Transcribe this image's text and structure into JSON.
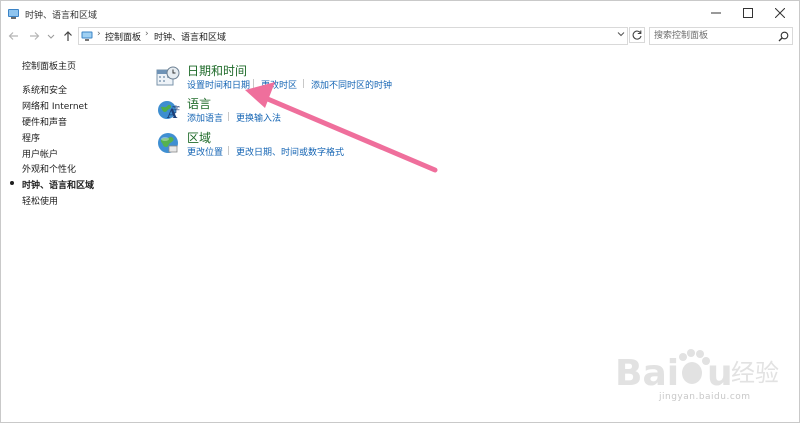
{
  "window": {
    "title": "时钟、语言和区域"
  },
  "address": {
    "crumbs": [
      "控制面板",
      "时钟、语言和区域"
    ]
  },
  "search": {
    "placeholder": "搜索控制面板"
  },
  "sidebar": {
    "items": [
      {
        "label": "控制面板主页"
      },
      {
        "label": "系统和安全"
      },
      {
        "label": "网络和 Internet"
      },
      {
        "label": "硬件和声音"
      },
      {
        "label": "程序"
      },
      {
        "label": "用户帐户"
      },
      {
        "label": "外观和个性化"
      },
      {
        "label": "时钟、语言和区域",
        "active": true
      },
      {
        "label": "轻松使用"
      }
    ]
  },
  "categories": [
    {
      "title": "日期和时间",
      "icon": "calendar-clock-icon",
      "links": [
        "设置时间和日期",
        "更改时区",
        "添加不同时区的时钟"
      ]
    },
    {
      "title": "语言",
      "icon": "language-globe-icon",
      "links": [
        "添加语言",
        "更换输入法"
      ]
    },
    {
      "title": "区域",
      "icon": "region-globe-icon",
      "links": [
        "更改位置",
        "更改日期、时间或数字格式"
      ]
    }
  ],
  "watermark": {
    "url": "jingyan.baidu.com"
  },
  "colors": {
    "link": "#1565b4",
    "category_title": "#1f6b2a",
    "annotation_arrow": "#ef6f9c"
  }
}
